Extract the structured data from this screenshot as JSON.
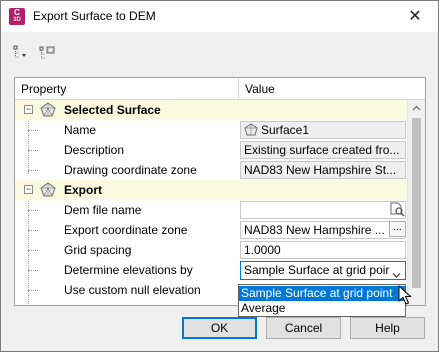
{
  "window": {
    "title": "Export Surface to DEM",
    "app_icon_letter": "C",
    "app_icon_sub": "3D",
    "app_icon_color": "#b0216a",
    "close_glyph": "✕"
  },
  "toolbar": {
    "items": [
      {
        "icon": "categorized-view-icon"
      },
      {
        "icon": "alphabetical-view-icon"
      }
    ]
  },
  "grid": {
    "header_property": "Property",
    "header_value": "Value",
    "group_bg": "#fafae1",
    "selected_surface": {
      "title": "Selected Surface",
      "expander": "−",
      "rows": [
        {
          "label": "Name",
          "value": "Surface1",
          "readonly": true
        },
        {
          "label": "Description",
          "value": "Existing surface created fro...",
          "readonly": true
        },
        {
          "label": "Drawing coordinate zone",
          "value": "NAD83 New Hampshire St...",
          "readonly": true
        }
      ]
    },
    "export": {
      "title": "Export",
      "expander": "−",
      "rows": [
        {
          "label": "Dem file name",
          "value": "",
          "readonly": false
        },
        {
          "label": "Export coordinate zone",
          "value": "NAD83 New Hampshire ...",
          "readonly": false,
          "button": "..."
        },
        {
          "label": "Grid spacing",
          "value": "1.0000",
          "readonly": false
        },
        {
          "label": "Determine elevations by",
          "value": "Sample Surface at grid poir",
          "readonly": false
        },
        {
          "label": "Use custom null elevation",
          "value": "",
          "readonly": false
        }
      ]
    }
  },
  "dropdown": {
    "options": [
      "Sample Surface at grid point",
      "Average"
    ],
    "selected": "Sample Surface at grid point",
    "highlight_color": "#0078d7"
  },
  "buttons": {
    "ok": "OK",
    "cancel": "Cancel",
    "help": "Help"
  }
}
